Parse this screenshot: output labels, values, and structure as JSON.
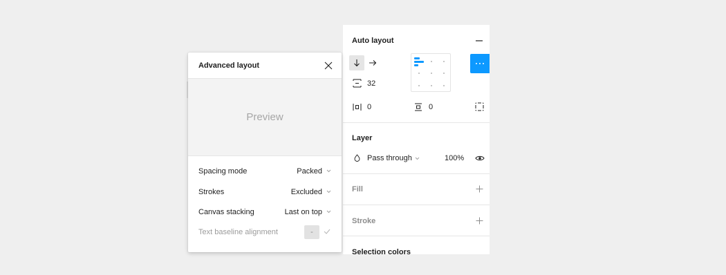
{
  "auto_layout": {
    "title": "Auto layout",
    "collapse_icon": "minus-icon",
    "direction_vertical_icon": "arrow-down-icon",
    "direction_horizontal_icon": "arrow-right-icon",
    "gap_icon": "vertical-gap-icon",
    "gap_value": "32",
    "horizontal_padding_icon": "horizontal-padding-icon",
    "horizontal_padding_value": "0",
    "vertical_padding_icon": "vertical-padding-icon",
    "vertical_padding_value": "0",
    "individual_padding_icon": "individual-padding-icon",
    "more_options_icon": "more-horizontal-icon"
  },
  "layer": {
    "title": "Layer",
    "blend_mode": "Pass through",
    "opacity": "100%"
  },
  "fill": {
    "title": "Fill"
  },
  "stroke": {
    "title": "Stroke"
  },
  "selection_colors": {
    "title": "Selection colors"
  },
  "advanced_layout": {
    "title": "Advanced layout",
    "preview_label": "Preview",
    "rows": [
      {
        "label": "Spacing mode",
        "value": "Packed"
      },
      {
        "label": "Strokes",
        "value": "Excluded"
      },
      {
        "label": "Canvas stacking",
        "value": "Last on top"
      },
      {
        "label": "Text baseline alignment",
        "value": "-"
      }
    ]
  },
  "colors": {
    "accent": "#0d99ff",
    "background": "#efefef",
    "panel": "#ffffff"
  }
}
